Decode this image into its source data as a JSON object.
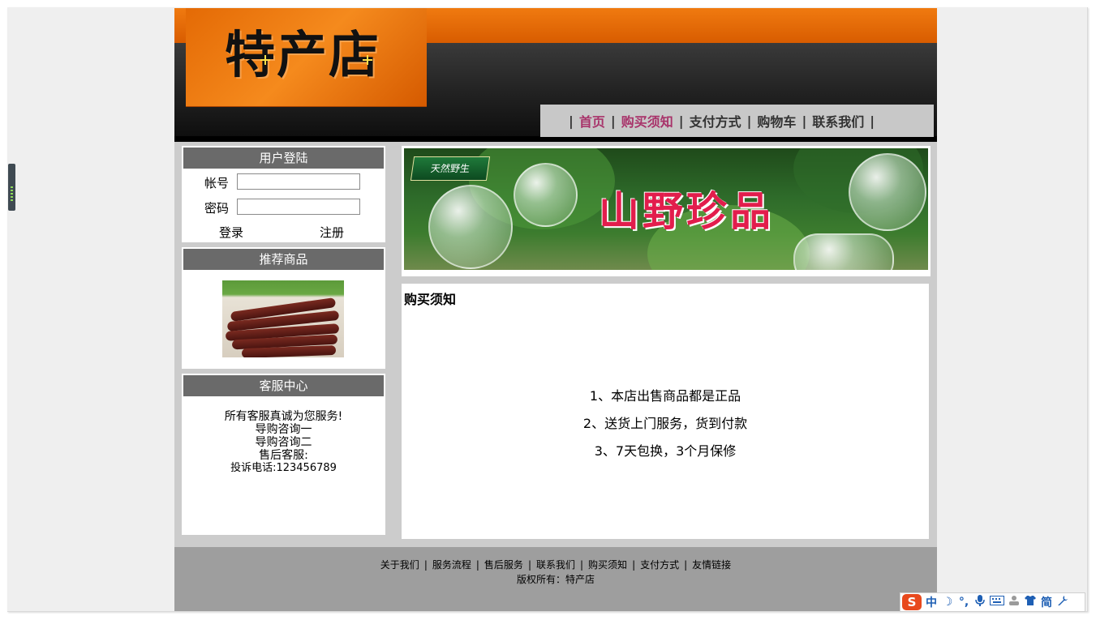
{
  "header": {
    "logo_text": "特产店"
  },
  "nav": {
    "items": [
      {
        "label": "首页",
        "active": true
      },
      {
        "label": "购买须知",
        "active": true
      },
      {
        "label": "支付方式",
        "active": false
      },
      {
        "label": "购物车",
        "active": false
      },
      {
        "label": "联系我们",
        "active": false
      }
    ],
    "separator": "|"
  },
  "login": {
    "title": "用户登陆",
    "account_label": "帐号",
    "account_value": "",
    "password_label": "密码",
    "password_value": "",
    "login_button": "登录",
    "register_button": "注册"
  },
  "recommend": {
    "title": "推荐商品"
  },
  "service": {
    "title": "客服中心",
    "lines": [
      "所有客服真诚为您服务!",
      "导购咨询一",
      "导购咨询二",
      "售后客服:",
      "投诉电话:123456789"
    ]
  },
  "banner": {
    "tag": "天然野生",
    "slogan": "山野珍品"
  },
  "content": {
    "title": "购买须知",
    "lines": [
      "1、本店出售商品都是正品",
      "2、送货上门服务，货到付款",
      "3、7天包换，3个月保修"
    ]
  },
  "footer": {
    "links": [
      "关于我们",
      "服务流程",
      "售后服务",
      "联系我们",
      "购买须知",
      "支付方式",
      "友情链接"
    ],
    "separator": "|",
    "copyright": "版权所有：特产店"
  },
  "ime": {
    "logo": "S",
    "items": [
      "中",
      "☽",
      "°,",
      "mic-icon",
      "keyboard-icon",
      "user-icon",
      "shirt-icon",
      "简",
      "wrench-icon"
    ],
    "labels": {
      "mode": "中",
      "script": "简"
    }
  },
  "colors": {
    "orange": "#f07a10",
    "nav_active": "#a8336a",
    "panel_header": "#6a6a6a",
    "page_bg": "#cccccc",
    "footer_bg": "#9e9e9e"
  }
}
